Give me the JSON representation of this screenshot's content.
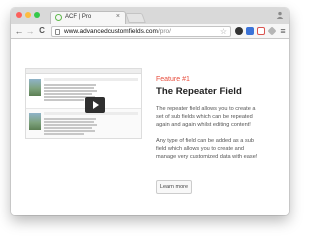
{
  "browser": {
    "tab": {
      "title": "ACF | Pro",
      "close_glyph": "×",
      "favicon": "acf-favicon-icon"
    },
    "nav": {
      "back_glyph": "←",
      "forward_glyph": "→",
      "reload_glyph": "C"
    },
    "address": {
      "domain": "www.advancedcustomfields.com",
      "path": "/pro/"
    },
    "star_glyph": "☆",
    "extensions": [
      "extension-icon-dark",
      "extension-icon-blue",
      "extension-icon-red",
      "extension-icon-gray"
    ],
    "menu_glyph": "≡"
  },
  "feature": {
    "label": "Feature #1",
    "title": "The Repeater Field",
    "description_lines": [
      "The repeater field allows you to create a",
      "set of sub fields which can be repeated",
      "again and again whilst editing content!"
    ],
    "description2_lines": [
      "Any type of field can be added as a sub",
      "field which allows you to create and",
      "manage very customized data with ease!"
    ],
    "button_label": "Learn more"
  },
  "colors": {
    "accent": "#e74c3c",
    "traffic_red": "#fc605c",
    "traffic_yellow": "#fdbc40",
    "traffic_green": "#34c84a"
  }
}
